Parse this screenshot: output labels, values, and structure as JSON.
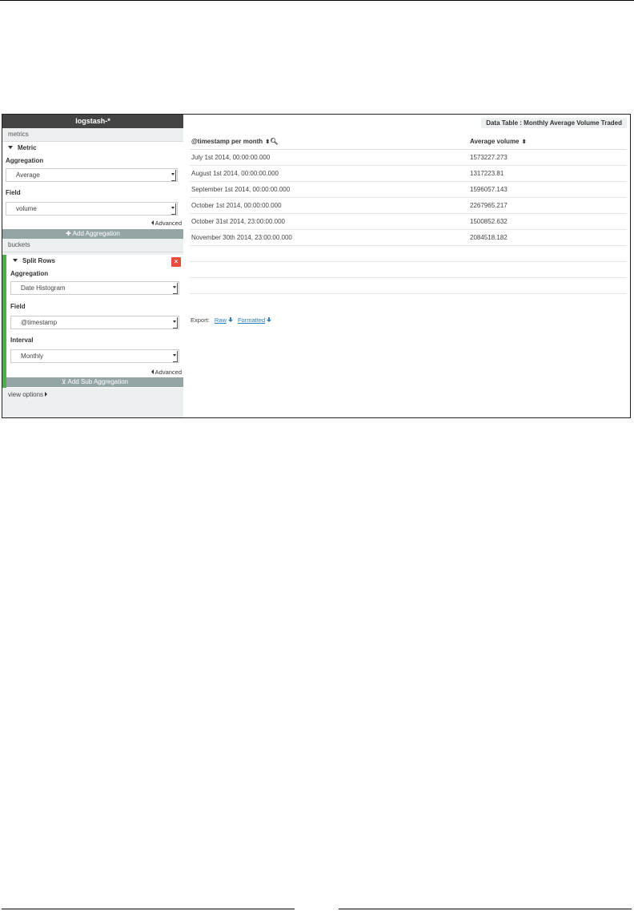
{
  "sidebar": {
    "index_pattern": "logstash-*",
    "metrics_label": "metrics",
    "metric": {
      "title": "Metric",
      "aggregation_label": "Aggregation",
      "aggregation_value": "Average",
      "field_label": "Field",
      "field_value": "volume",
      "advanced_label": "Advanced"
    },
    "add_aggregation_label": "Add Aggregation",
    "buckets_label": "buckets",
    "split_rows": {
      "title": "Split Rows",
      "close_label": "×",
      "aggregation_label": "Aggregation",
      "aggregation_value": "Date Histogram",
      "field_label": "Field",
      "field_value": "@timestamp",
      "interval_label": "Interval",
      "interval_value": "Monthly",
      "advanced_label": "Advanced"
    },
    "add_sub_aggregation_label": "Add Sub Aggregation",
    "view_options_label": "view options"
  },
  "main": {
    "vis_title": "Data Table : Monthly Average Volume Traded",
    "columns": [
      "@timestamp per month",
      "Average volume"
    ],
    "rows": [
      [
        "July 1st 2014, 00:00:00.000",
        "1573227.273"
      ],
      [
        "August 1st 2014, 00:00:00.000",
        "1317223.81"
      ],
      [
        "September 1st 2014, 00:00:00.000",
        "1596057.143"
      ],
      [
        "October 1st 2014, 00:00:00.000",
        "2267965.217"
      ],
      [
        "October 31st 2014, 23:00:00.000",
        "1500852.632"
      ],
      [
        "November 30th 2014, 23:00:00.000",
        "2084518.182"
      ]
    ],
    "export_label": "Export:",
    "export_raw": "Raw",
    "export_formatted": "Formatted"
  }
}
